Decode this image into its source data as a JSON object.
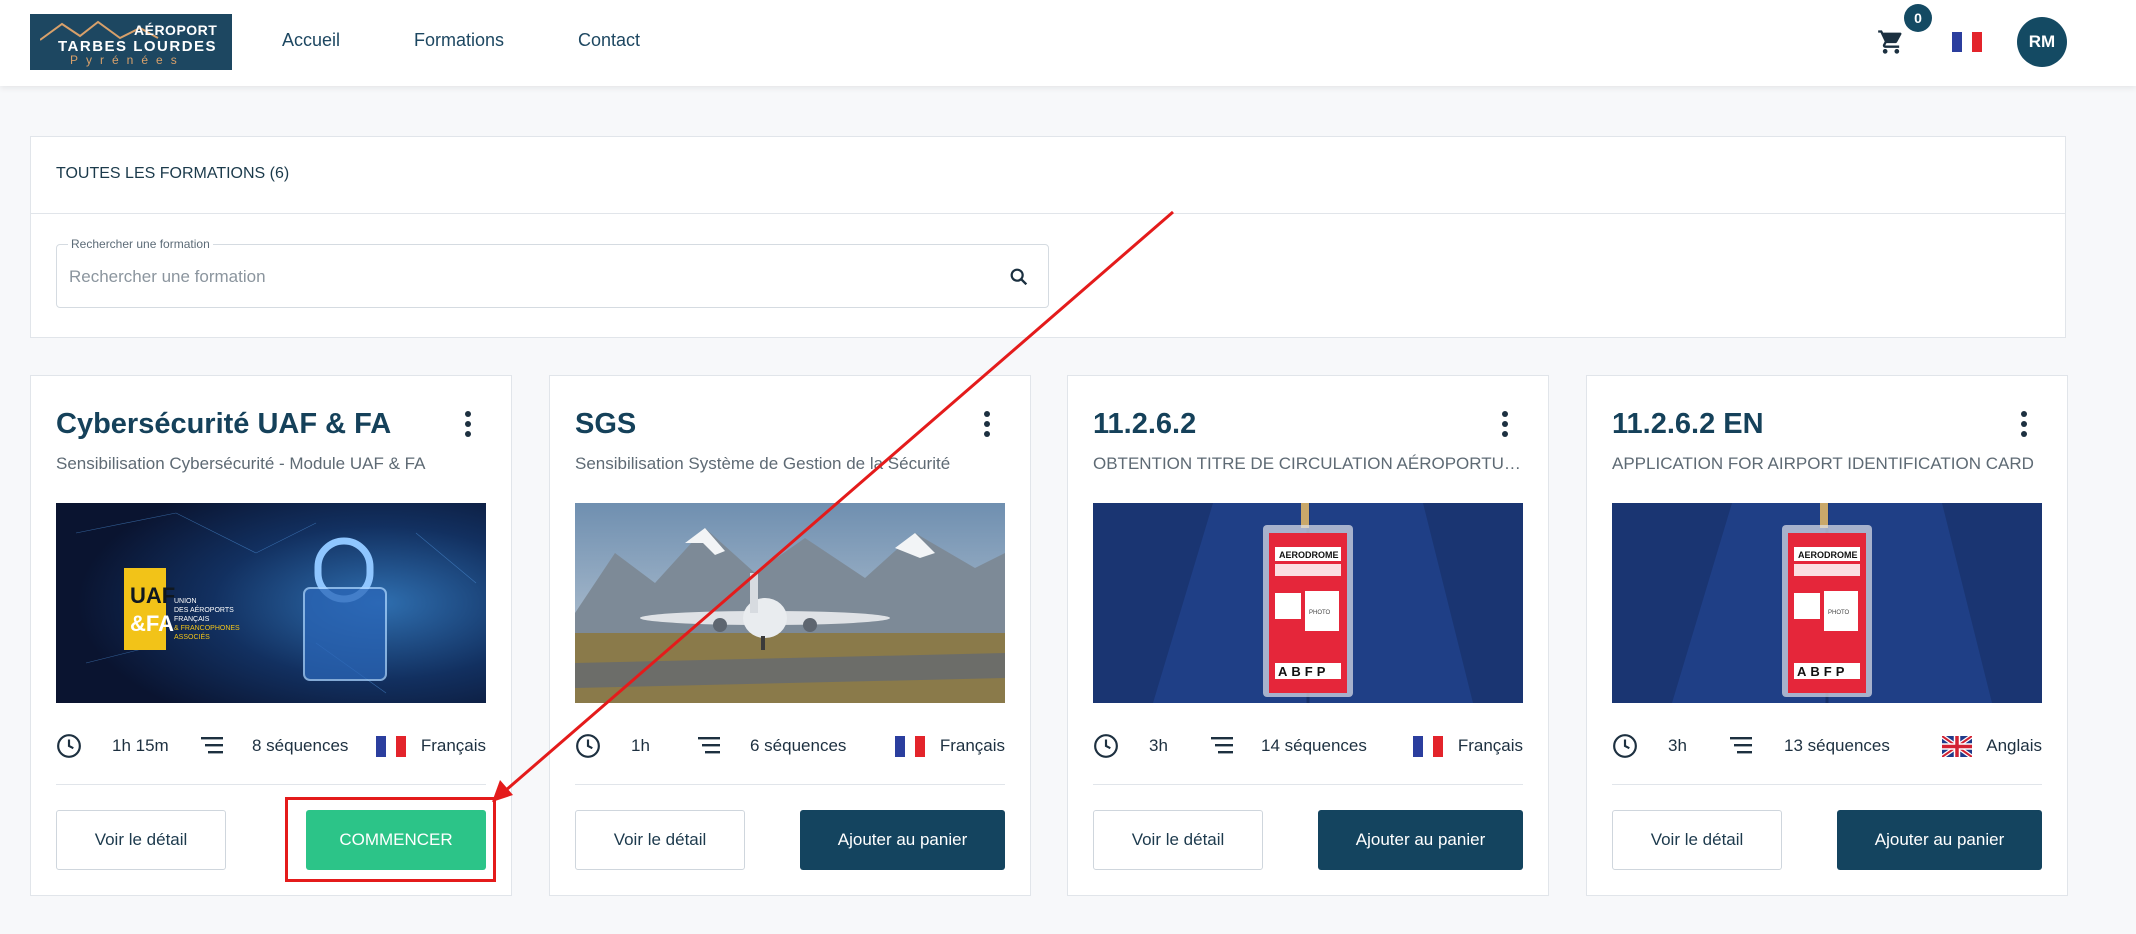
{
  "header": {
    "logo": {
      "line1": "AÉROPORT",
      "line2": "TARBES LOURDES",
      "line3": "Pyrénées"
    },
    "nav": [
      {
        "label": "Accueil"
      },
      {
        "label": "Formations"
      },
      {
        "label": "Contact"
      }
    ],
    "cart_count": "0",
    "avatar_initials": "RM"
  },
  "panel": {
    "title": "TOUTES LES FORMATIONS (6)",
    "search_label": "Rechercher une formation",
    "search_placeholder": "Rechercher une formation"
  },
  "cards": [
    {
      "title": "Cybersécurité UAF & FA",
      "subtitle": "Sensibilisation Cybersécurité - Module UAF & FA",
      "duration": "1h 15m",
      "sequences": "8 séquences",
      "language": "Français",
      "detail_label": "Voir le détail",
      "action_label": "COMMENCER",
      "image_text": {
        "logo_line1": "UAF",
        "logo_line2": "&FA",
        "caption1": "UNION",
        "caption2": "DES AÉROPORTS",
        "caption3": "FRANÇAIS",
        "caption4": "& FRANCOPHONES",
        "caption5": "ASSOCIÉS"
      }
    },
    {
      "title": "SGS",
      "subtitle": "Sensibilisation Système de Gestion de la Sécurité",
      "duration": "1h",
      "sequences": "6 séquences",
      "language": "Français",
      "detail_label": "Voir le détail",
      "action_label": "Ajouter au panier"
    },
    {
      "title": "11.2.6.2",
      "subtitle": "OBTENTION TITRE DE CIRCULATION AÉROPORTUAIRE",
      "duration": "3h",
      "sequences": "14 séquences",
      "language": "Français",
      "detail_label": "Voir le détail",
      "action_label": "Ajouter au panier",
      "badge_text": {
        "header": "AERODROME",
        "photo": "PHOTO",
        "letters": "ABFP"
      }
    },
    {
      "title": "11.2.6.2 EN",
      "subtitle": "APPLICATION FOR AIRPORT IDENTIFICATION CARD",
      "duration": "3h",
      "sequences": "13 séquences",
      "language": "Anglais",
      "detail_label": "Voir le détail",
      "action_label": "Ajouter au panier",
      "badge_text": {
        "header": "AERODROME",
        "photo": "PHOTO",
        "letters": "ABFP"
      }
    }
  ],
  "colors": {
    "primary": "#14445f",
    "start_button": "#2cc488",
    "annotation": "#e41b1b"
  }
}
